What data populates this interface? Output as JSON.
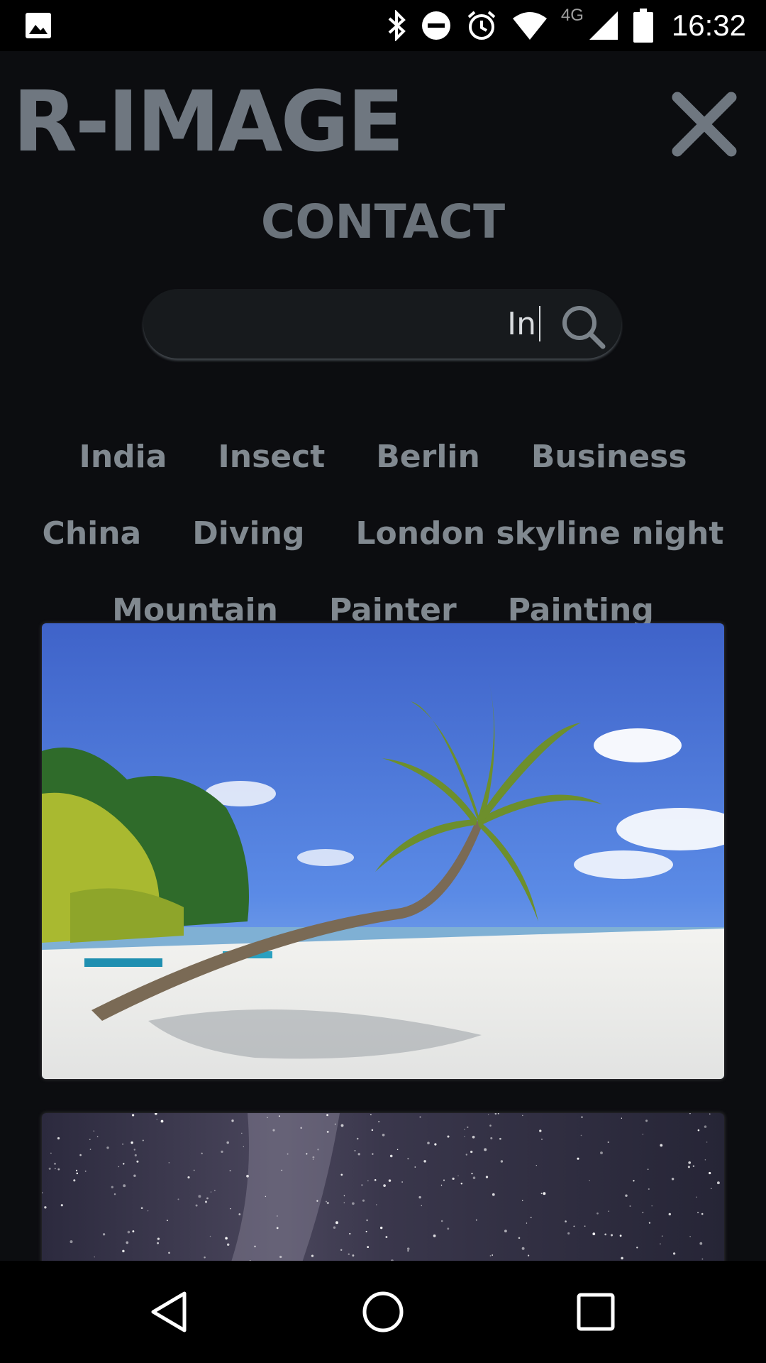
{
  "status_bar": {
    "time": "16:32",
    "network": "4G",
    "icons": [
      "gallery-icon",
      "bluetooth-icon",
      "do-not-disturb-icon",
      "alarm-icon",
      "wifi-icon",
      "signal-icon",
      "battery-icon"
    ]
  },
  "header": {
    "brand": "R-IMAGE",
    "close_icon": "close-icon"
  },
  "nav": {
    "contact": "CONTACT"
  },
  "search": {
    "value": "In",
    "icon": "search-icon"
  },
  "tags": [
    "India",
    "Insect",
    "Berlin",
    "Business",
    "China",
    "Diving",
    "London skyline night",
    "Mountain",
    "Painter",
    "Painting"
  ],
  "results": [
    {
      "subject": "tropical beach with leaning palm tree"
    },
    {
      "subject": "starry night sky with milky way"
    }
  ],
  "system_nav": [
    "back-icon",
    "home-icon",
    "recents-icon"
  ],
  "colors": {
    "background": "#0c0d10",
    "brand": "#6f7780",
    "tag": "#818990",
    "search_bg": "#171a1d"
  }
}
